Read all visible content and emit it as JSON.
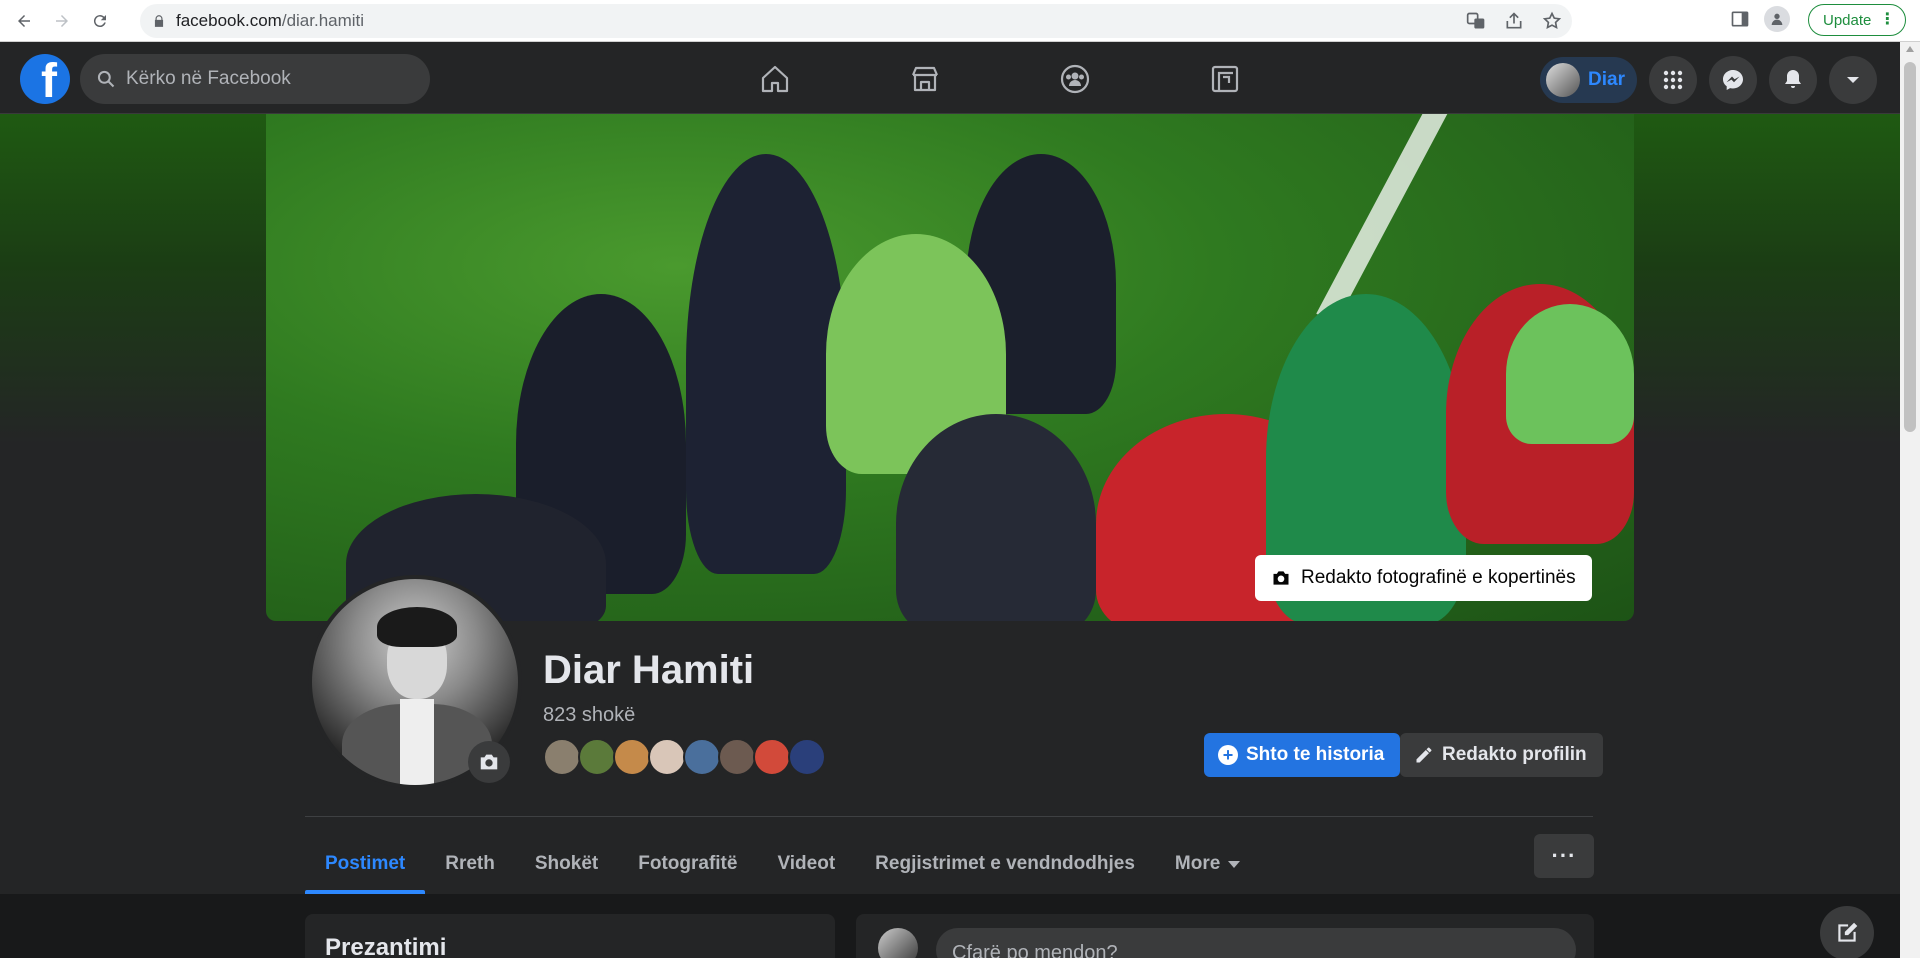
{
  "browser": {
    "url_host": "facebook.com",
    "url_path": "/diar.hamiti",
    "update_label": "Update"
  },
  "fb": {
    "search_placeholder": "Kërko në Facebook",
    "me_name": "Diar",
    "nav_icons": [
      "home-icon",
      "marketplace-icon",
      "groups-icon",
      "gaming-icon"
    ],
    "right_icons": [
      "menu-grid-icon",
      "messenger-icon",
      "notifications-icon",
      "account-caret-icon"
    ]
  },
  "profile": {
    "edit_cover_label": "Redakto fotografinë e kopertinës",
    "name": "Diar Hamiti",
    "friends_count": "823 shokë",
    "add_story_label": "Shto te historia",
    "edit_profile_label": "Redakto profilin",
    "friend_avatar_colors": [
      "#8a7f6e",
      "#5b7a3a",
      "#c58a4a",
      "#d9c6b8",
      "#4a6f9c",
      "#6c5a50",
      "#d24a3a",
      "#2a3f7a"
    ]
  },
  "tabs": [
    {
      "label": "Postimet",
      "active": true
    },
    {
      "label": "Rreth",
      "active": false
    },
    {
      "label": "Shokët",
      "active": false
    },
    {
      "label": "Fotografitë",
      "active": false
    },
    {
      "label": "Videot",
      "active": false
    },
    {
      "label": "Regjistrimet e vendndodhjes",
      "active": false
    }
  ],
  "tabs_more_label": "More",
  "tabs_overflow_label": "···",
  "intro_title": "Prezantimi",
  "composer_placeholder": "Çfarë po mendon?",
  "colors": {
    "accent": "#2d88ff",
    "button_blue": "#2374e1",
    "bg": "#18191a",
    "surface": "#242526"
  }
}
